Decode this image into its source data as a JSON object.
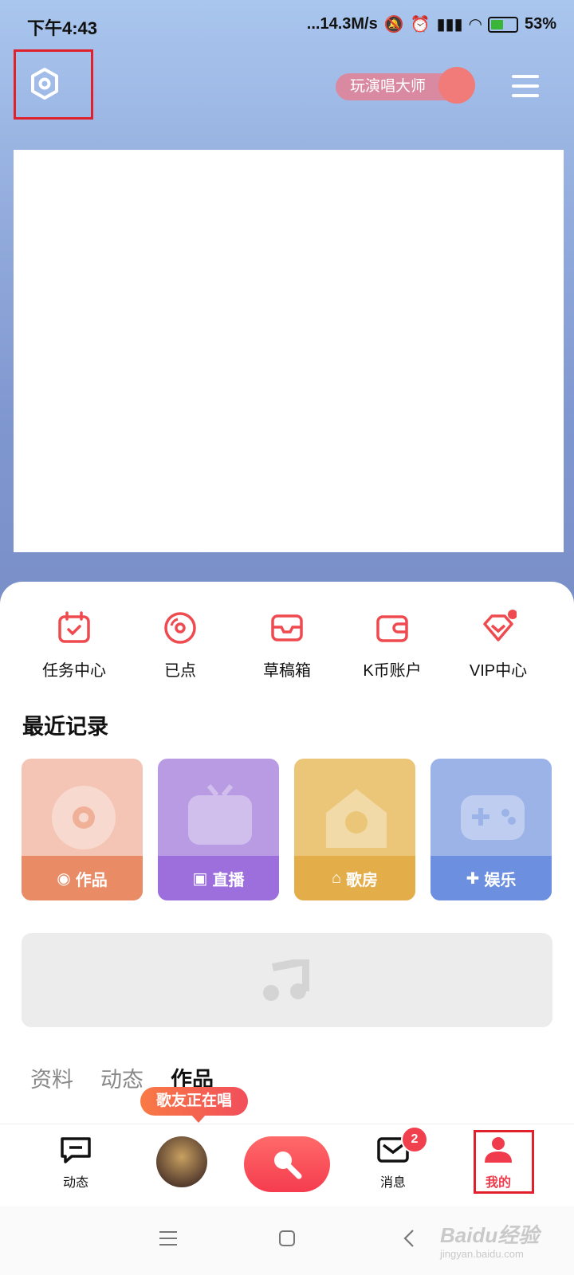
{
  "status_bar": {
    "time": "下午4:43",
    "network_speed": "...14.3M/s",
    "battery": "53%"
  },
  "header": {
    "master_label": "玩演唱大师"
  },
  "quick_actions": [
    {
      "label": "任务中心",
      "icon": "calendar-check-icon"
    },
    {
      "label": "已点",
      "icon": "disc-icon"
    },
    {
      "label": "草稿箱",
      "icon": "inbox-icon"
    },
    {
      "label": "K币账户",
      "icon": "wallet-icon"
    },
    {
      "label": "VIP中心",
      "icon": "diamond-icon"
    }
  ],
  "recent": {
    "title": "最近记录",
    "items": [
      {
        "label": "作品",
        "icon": "disc-icon",
        "color": "#e98b64"
      },
      {
        "label": "直播",
        "icon": "live-tv-icon",
        "color": "#9c6fdc"
      },
      {
        "label": "歌房",
        "icon": "room-icon",
        "color": "#e3ae49"
      },
      {
        "label": "娱乐",
        "icon": "gamepad-icon",
        "color": "#6c8fe0"
      }
    ]
  },
  "profile_tabs": {
    "tab1": "资料",
    "tab2": "动态",
    "tab3": "作品"
  },
  "singing_bubble": "歌友正在唱",
  "tab_bar": {
    "feed": "动态",
    "messages": "消息",
    "mine": "我的",
    "messages_badge": "2"
  },
  "watermark": {
    "main": "Baidu经验",
    "sub": "jingyan.baidu.com"
  }
}
